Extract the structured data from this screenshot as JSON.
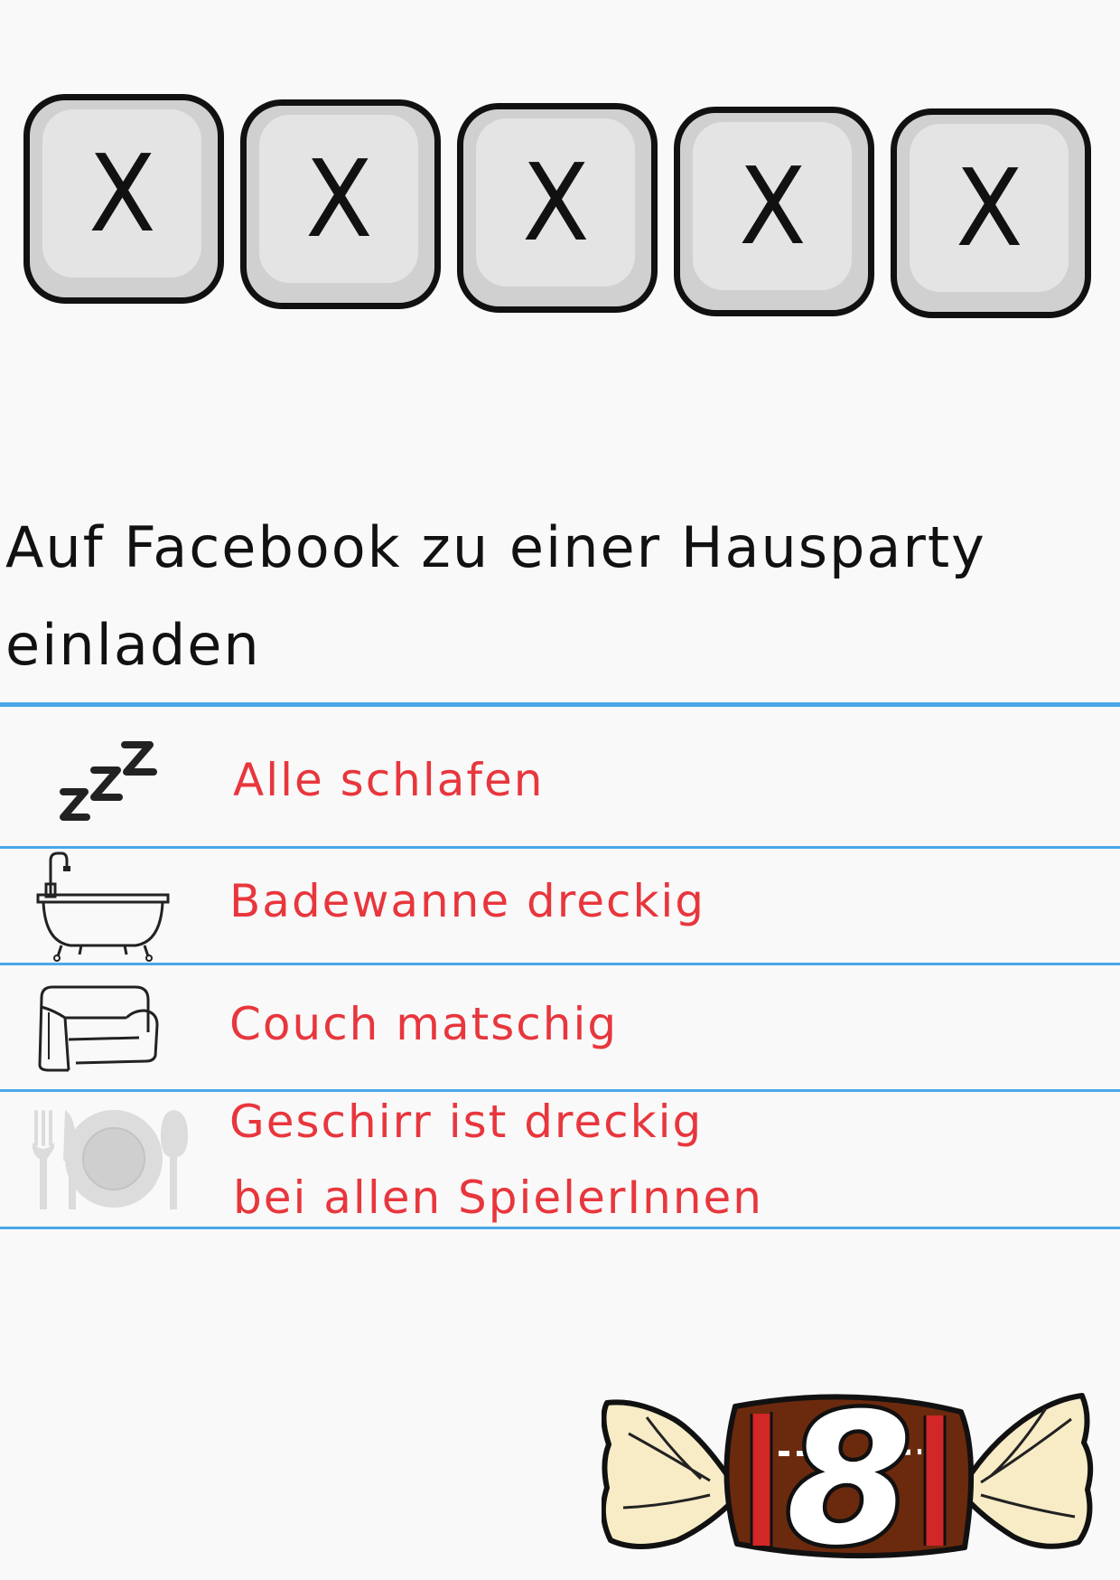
{
  "keys": [
    "X",
    "X",
    "X",
    "X",
    "X"
  ],
  "title": {
    "line1": "Auf Facebook zu einer Hausparty",
    "line2": "einladen"
  },
  "rows": [
    {
      "icon": "sleep-zzz-icon",
      "text": "Alle schlafen"
    },
    {
      "icon": "bathtub-icon",
      "text": "Badewanne dreckig"
    },
    {
      "icon": "couch-icon",
      "text": "Couch matschig"
    },
    {
      "icon": "plate-cutlery-icon",
      "line1": "Geschirr ist dreckig",
      "line2": "bei allen SpielerInnen"
    }
  ],
  "candy": {
    "number": "8"
  },
  "colors": {
    "background": "#f9f9f9",
    "key_fill": "#d0d0d0",
    "rule": "#4aa7e8",
    "row_text": "#e8363d",
    "candy_wrapper": "#f7ecc6",
    "candy_body": "#6b2a0e",
    "candy_band": "#d32626"
  }
}
